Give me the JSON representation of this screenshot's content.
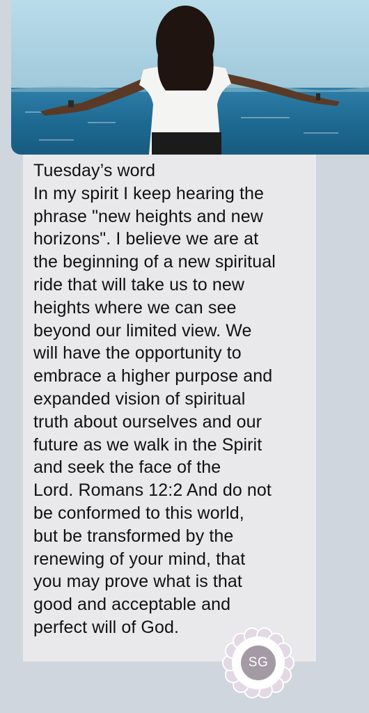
{
  "message": {
    "header": "Tuesday’s word",
    "lines": [
      "In my spirit I keep hearing the",
      "phrase \"new heights and new",
      "horizons\". I believe we are at",
      "the beginning of a new spiritual",
      "ride that will take us to new",
      "heights where we can see",
      "beyond our limited view. We",
      "will have the opportunity to",
      "embrace a higher purpose and",
      "expanded vision of spiritual",
      "truth about ourselves and our",
      "future as we walk in the Spirit",
      "and seek the face of the",
      "Lord. Romans 12:2 And do not",
      "be conformed to this world,",
      "but be transformed by the",
      "renewing of your mind, that",
      "you may prove what is that",
      "good and acceptable and",
      "perfect will of God."
    ]
  },
  "sender": {
    "initials": "SG",
    "avatar_color": "#a39aa5",
    "petal_color": "#e2d9e5"
  },
  "photo": {
    "icon": "woman-arms-outstretched-by-sea-image",
    "sky_color": "#a8cfe0",
    "sea_color": "#1f6f9a"
  }
}
